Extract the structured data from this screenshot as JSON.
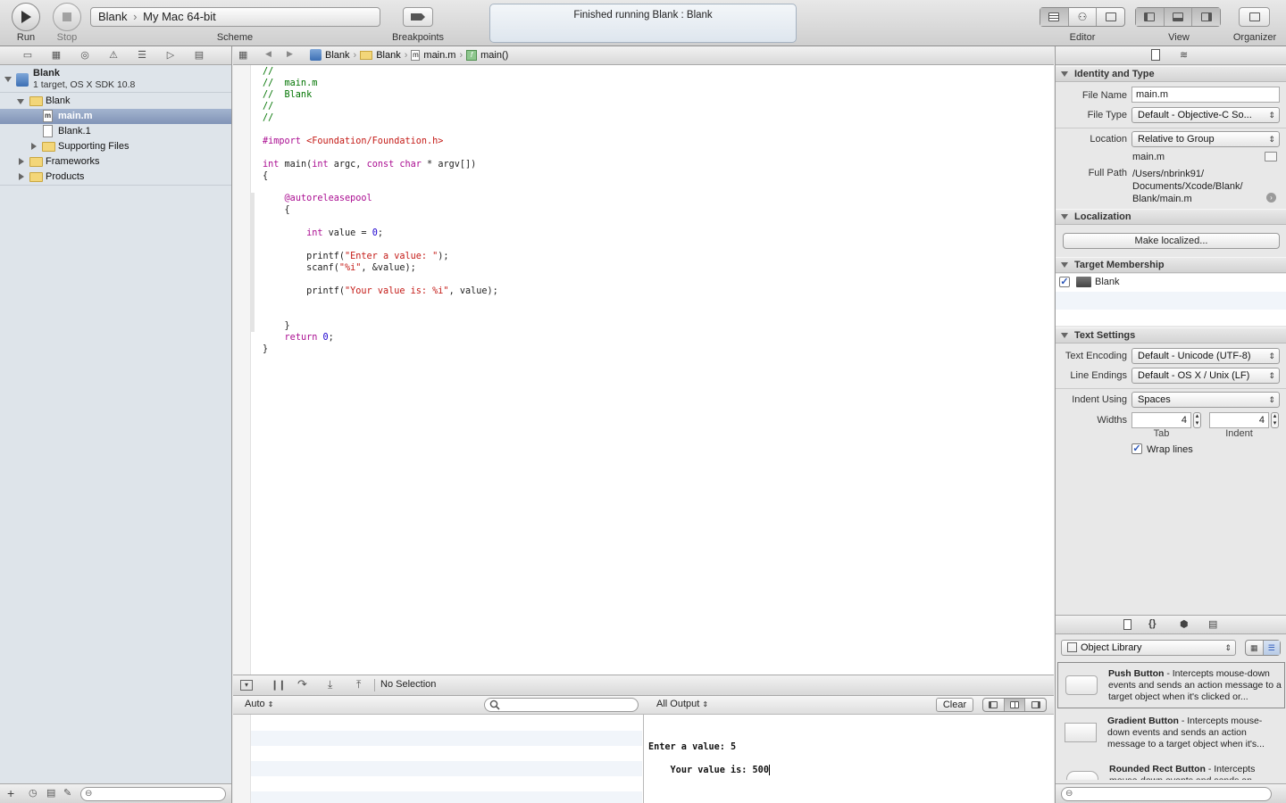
{
  "toolbar": {
    "run_label": "Run",
    "stop_label": "Stop",
    "scheme_label": "Scheme",
    "scheme_target": "Blank",
    "scheme_destination": "My Mac 64-bit",
    "breakpoints_label": "Breakpoints",
    "activity_status": "Finished running Blank : Blank",
    "editor_label": "Editor",
    "view_label": "View",
    "organizer_label": "Organizer"
  },
  "navigator": {
    "project_name": "Blank",
    "project_subtitle": "1 target, OS X SDK 10.8",
    "items": [
      {
        "label": "Blank",
        "kind": "folder",
        "level": 1,
        "expanded": true
      },
      {
        "label": "main.m",
        "kind": "file-m",
        "level": 2,
        "selected": true
      },
      {
        "label": "Blank.1",
        "kind": "file",
        "level": 2
      },
      {
        "label": "Supporting Files",
        "kind": "folder",
        "level": 2,
        "expanded": false
      },
      {
        "label": "Frameworks",
        "kind": "folder",
        "level": 1,
        "expanded": false
      },
      {
        "label": "Products",
        "kind": "folder",
        "level": 1,
        "expanded": false
      }
    ]
  },
  "jumpbar": {
    "crumbs": [
      "Blank",
      "Blank",
      "main.m",
      "main()"
    ]
  },
  "editor": {
    "lines": [
      "//",
      "//  main.m",
      "//  Blank",
      "//",
      "//",
      "",
      "#import <Foundation/Foundation.h>",
      "",
      "int main(int argc, const char * argv[])",
      "{",
      "",
      "    @autoreleasepool",
      "    {",
      "",
      "        int value = 0;",
      "",
      "        printf(\"Enter a value: \");",
      "        scanf(\"%i\", &value);",
      "",
      "        printf(\"Your value is: %i\", value);",
      "",
      "",
      "    }",
      "    return 0;",
      "}"
    ]
  },
  "debug": {
    "selection_text": "No Selection",
    "vars_scope": "Auto",
    "output_scope": "All Output",
    "clear_label": "Clear",
    "console_lines": [
      "Enter a value: 5",
      "Your value is: 500"
    ]
  },
  "inspector": {
    "identity_title": "Identity and Type",
    "file_name_label": "File Name",
    "file_name_value": "main.m",
    "file_type_label": "File Type",
    "file_type_value": "Default - Objective-C So...",
    "location_label": "Location",
    "location_value": "Relative to Group",
    "location_file": "main.m",
    "full_path_label": "Full Path",
    "full_path_lines": [
      "/Users/nbrink91/",
      "Documents/Xcode/Blank/",
      "Blank/main.m"
    ],
    "localization_title": "Localization",
    "make_localized_label": "Make localized...",
    "target_membership_title": "Target Membership",
    "target_name": "Blank",
    "text_settings_title": "Text Settings",
    "text_encoding_label": "Text Encoding",
    "text_encoding_value": "Default - Unicode (UTF-8)",
    "line_endings_label": "Line Endings",
    "line_endings_value": "Default - OS X / Unix (LF)",
    "indent_using_label": "Indent Using",
    "indent_using_value": "Spaces",
    "widths_label": "Widths",
    "tab_width": "4",
    "indent_width": "4",
    "tab_caption": "Tab",
    "indent_caption": "Indent",
    "wrap_lines_label": "Wrap lines"
  },
  "library": {
    "selector_value": "Object Library",
    "items": [
      {
        "name": "Push Button",
        "desc": " - Intercepts mouse-down events and sends an action message to a target object when it's clicked or..."
      },
      {
        "name": "Gradient Button",
        "desc": " - Intercepts mouse-down events and sends an action message to a target object when it's..."
      },
      {
        "name": "Rounded Rect Button",
        "desc": " - Intercepts mouse-down events and sends an..."
      }
    ]
  },
  "colors": {
    "comment": "#007400",
    "keyword": "#aa0d91",
    "string": "#c41a16",
    "number": "#1c00cf",
    "selection": "#8194b7"
  }
}
